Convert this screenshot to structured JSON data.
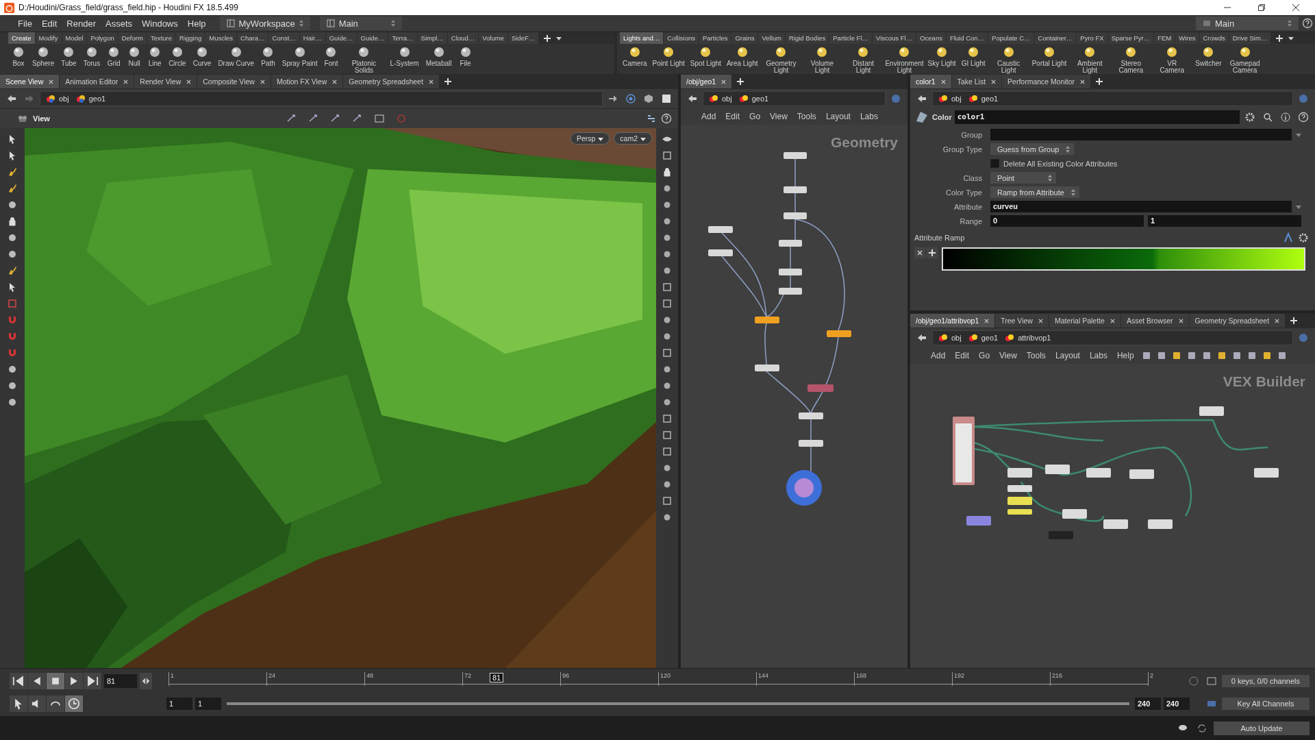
{
  "title_bar": {
    "title": "D:/Houdini/Grass_field/grass_field.hip - Houdini FX 18.5.499"
  },
  "menu": [
    "File",
    "Edit",
    "Render",
    "Assets",
    "Windows",
    "Help"
  ],
  "desktops": [
    {
      "label": "MyWorkspace"
    },
    {
      "label": "Main"
    }
  ],
  "desktop_right": {
    "label": "Main"
  },
  "shelf_left": {
    "tabs": [
      {
        "label": "Create",
        "selected": true
      },
      {
        "label": "Modify",
        "selected": false
      },
      {
        "label": "Model",
        "selected": false
      },
      {
        "label": "Polygon",
        "selected": false
      },
      {
        "label": "Deform",
        "selected": false
      },
      {
        "label": "Texture",
        "selected": false
      },
      {
        "label": "Rigging",
        "selected": false
      },
      {
        "label": "Muscles",
        "selected": false
      },
      {
        "label": "Chara…",
        "selected": false
      },
      {
        "label": "Const…",
        "selected": false
      },
      {
        "label": "Hair…",
        "selected": false
      },
      {
        "label": "Guide…",
        "selected": false
      },
      {
        "label": "Guide…",
        "selected": false
      },
      {
        "label": "Terra…",
        "selected": false
      },
      {
        "label": "Simpl…",
        "selected": false
      },
      {
        "label": "Cloud…",
        "selected": false
      },
      {
        "label": "Volume",
        "selected": false
      },
      {
        "label": "SideF…",
        "selected": false
      }
    ],
    "tools": [
      "Box",
      "Sphere",
      "Tube",
      "Torus",
      "Grid",
      "Null",
      "Line",
      "Circle",
      "Curve",
      "Draw Curve",
      "Path",
      "Spray Paint",
      "Font",
      "Platonic Solids",
      "L-System",
      "Metaball",
      "File"
    ]
  },
  "shelf_right": {
    "tabs": [
      {
        "label": "Lights and…",
        "selected": true
      },
      {
        "label": "Collisions",
        "selected": false
      },
      {
        "label": "Particles",
        "selected": false
      },
      {
        "label": "Grains",
        "selected": false
      },
      {
        "label": "Vellum",
        "selected": false
      },
      {
        "label": "Rigid Bodies",
        "selected": false
      },
      {
        "label": "Particle Fl…",
        "selected": false
      },
      {
        "label": "Viscous Fl…",
        "selected": false
      },
      {
        "label": "Oceans",
        "selected": false
      },
      {
        "label": "Fluid Con…",
        "selected": false
      },
      {
        "label": "Populate C…",
        "selected": false
      },
      {
        "label": "Container…",
        "selected": false
      },
      {
        "label": "Pyro FX",
        "selected": false
      },
      {
        "label": "Sparse Pyr…",
        "selected": false
      },
      {
        "label": "FEM",
        "selected": false
      },
      {
        "label": "Wires",
        "selected": false
      },
      {
        "label": "Crowds",
        "selected": false
      },
      {
        "label": "Drive Sim…",
        "selected": false
      }
    ],
    "tools": [
      "Camera",
      "Point Light",
      "Spot Light",
      "Area Light",
      "Geometry Light",
      "Volume Light",
      "Distant Light",
      "Environment Light",
      "Sky Light",
      "GI Light",
      "Caustic Light",
      "Portal Light",
      "Ambient Light",
      "Stereo Camera",
      "VR Camera",
      "Switcher",
      "Gamepad Camera"
    ]
  },
  "scene_pane": {
    "tabs": [
      {
        "label": "Scene View",
        "selected": true
      },
      {
        "label": "Animation Editor",
        "selected": false
      },
      {
        "label": "Render View",
        "selected": false
      },
      {
        "label": "Composite View",
        "selected": false
      },
      {
        "label": "Motion FX View",
        "selected": false
      },
      {
        "label": "Geometry Spreadsheet",
        "selected": false
      }
    ],
    "path": [
      "obj",
      "geo1"
    ],
    "toolbar_title": "View",
    "camera_menus": [
      "Persp",
      "cam2"
    ]
  },
  "network_pane": {
    "tabs": [
      {
        "label": "/obj/geo1",
        "selected": true
      }
    ],
    "path": [
      "obj",
      "geo1"
    ],
    "menu": [
      "Add",
      "Edit",
      "Go",
      "View",
      "Tools",
      "Layout",
      "Labs"
    ],
    "context": "Geometry"
  },
  "parameter_pane": {
    "tabs": [
      {
        "label": "color1",
        "selected": true
      },
      {
        "label": "Take List",
        "selected": false
      },
      {
        "label": "Performance Monitor",
        "selected": false
      }
    ],
    "path": [
      "obj",
      "geo1"
    ],
    "node_type": "Color",
    "node_name": "color1",
    "params": [
      {
        "kind": "combo",
        "label": "Group"
      },
      {
        "kind": "menu",
        "label": "Group Type",
        "value": "Guess from Group"
      },
      {
        "kind": "checkbox",
        "label": "Delete All Existing Color Attributes",
        "checked": false
      },
      {
        "kind": "menu",
        "label": "Class",
        "value": "Point"
      },
      {
        "kind": "menu",
        "label": "Color Type",
        "value": "Ramp from Attribute"
      },
      {
        "kind": "combo",
        "label": "Attribute",
        "value": "curveu"
      },
      {
        "kind": "pair",
        "label": "Range",
        "values": [
          "0",
          "1"
        ]
      }
    ],
    "ramp_label": "Attribute Ramp"
  },
  "vex_pane": {
    "tabs": [
      {
        "label": "/obj/geo1/attribvop1",
        "selected": true
      },
      {
        "label": "Tree View",
        "selected": false
      },
      {
        "label": "Material Palette",
        "selected": false
      },
      {
        "label": "Asset Browser",
        "selected": false
      },
      {
        "label": "Geometry Spreadsheet",
        "selected": false
      }
    ],
    "path": [
      "obj",
      "geo1",
      "attribvop1"
    ],
    "menu": [
      "Add",
      "Edit",
      "Go",
      "View",
      "Tools",
      "Layout",
      "Labs",
      "Help"
    ],
    "context": "VEX Builder"
  },
  "timeline": {
    "current_frame": "81",
    "ticks": [
      "1",
      "24",
      "48",
      "72",
      "96",
      "120",
      "144",
      "168",
      "192",
      "216",
      "2"
    ],
    "playhead": {
      "label": "81",
      "level": 0.335
    },
    "range": [
      "1",
      "1"
    ],
    "range_slider": {
      "level": 1
    },
    "end": [
      "240",
      "240"
    ],
    "keys": "0 keys, 0/0 channels",
    "key_mode": "Key All Channels"
  },
  "status_bar": {
    "update_mode": "Auto Update"
  }
}
